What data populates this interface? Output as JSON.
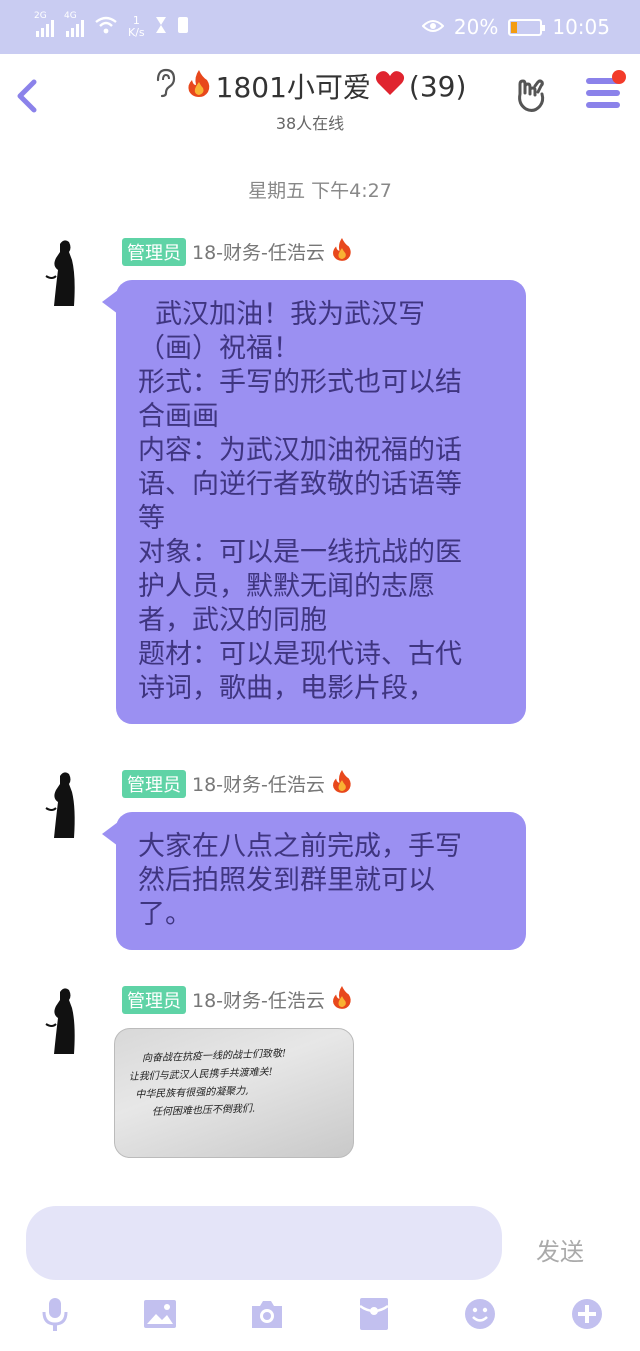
{
  "status_bar": {
    "sig1_label": "2G",
    "sig2_label": "4G",
    "speed_value": "1",
    "speed_unit": "K/s",
    "battery_pct": "20%",
    "time": "10:05"
  },
  "header": {
    "group_name": "1801小可爱",
    "member_count": "(39)",
    "online": "38人在线"
  },
  "timestamp": "星期五 下午4:27",
  "messages": [
    {
      "badge": "管理员",
      "sender": "18-财务-任浩云",
      "text": "  武汉加油！我为武汉写\n（画）祝福！\n形式：手写的形式也可以结\n合画画\n内容：为武汉加油祝福的话\n语、向逆行者致敬的话语等\n等\n对象：可以是一线抗战的医\n护人员，默默无闻的志愿\n者，武汉的同胞\n题材：可以是现代诗、古代\n诗词，歌曲，电影片段，"
    },
    {
      "badge": "管理员",
      "sender": "18-财务-任浩云",
      "text": "大家在八点之前完成，手写\n然后拍照发到群里就可以\n了。"
    },
    {
      "badge": "管理员",
      "sender": "18-财务-任浩云",
      "photo_lines": [
        "向奋战在抗疫一线的战士们致敬!",
        "让我们与武汉人民携手共渡难关!",
        "中华民族有很强的凝聚力,",
        "任何困难也压不倒我们."
      ]
    }
  ],
  "input": {
    "send_label": "发送"
  },
  "colors": {
    "accent": "#8b82ea",
    "bubble": "#9b90f2",
    "badge": "#5fd3a6",
    "status_bar": "#c9ccf2"
  },
  "icons": [
    "back-icon",
    "ear-icon",
    "fire-icon",
    "heart-icon",
    "gesture-icon",
    "menu-icon",
    "mic-icon",
    "image-icon",
    "camera-icon",
    "redpacket-icon",
    "emoji-icon",
    "plus-icon"
  ]
}
